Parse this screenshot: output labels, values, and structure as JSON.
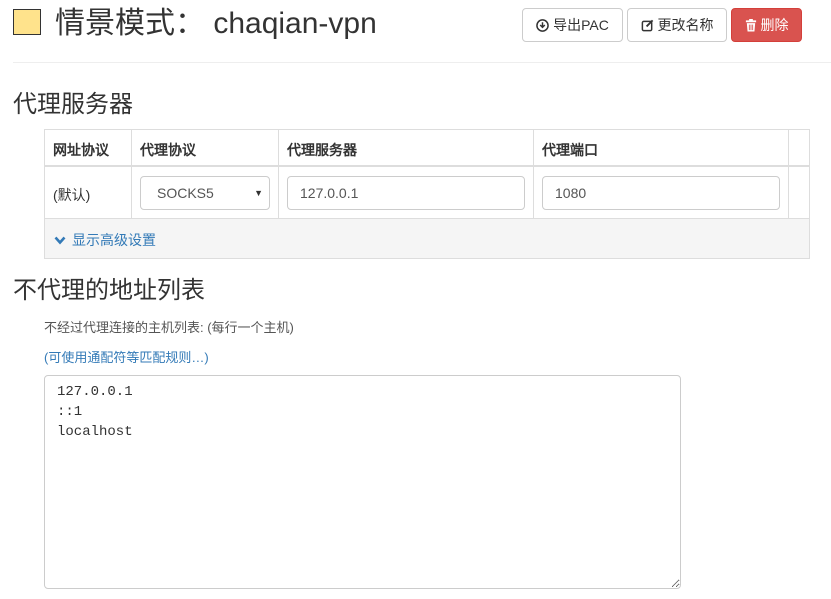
{
  "header": {
    "profile_color": "#ffe38c",
    "title": "情景模式： chaqian-vpn",
    "buttons": {
      "export": {
        "label": "导出PAC",
        "icon": "download-circle-icon"
      },
      "rename": {
        "label": "更改名称",
        "icon": "edit-icon"
      },
      "delete": {
        "label": "删除",
        "icon": "trash-icon",
        "color": "#d9534f"
      }
    }
  },
  "proxy_section": {
    "heading": "代理服务器",
    "columns": [
      "网址协议",
      "代理协议",
      "代理服务器",
      "代理端口"
    ],
    "rows": [
      {
        "scheme": "(默认)",
        "protocol": "SOCKS5",
        "server": "127.0.0.1",
        "port": "1080"
      }
    ],
    "advanced_link": {
      "label": "显示高级设置",
      "icon": "chevron-down-icon"
    }
  },
  "bypass_section": {
    "heading": "不代理的地址列表",
    "help_text": "不经过代理连接的主机列表: (每行一个主机)",
    "wildcard_link": "(可使用通配符等匹配规则…)",
    "entries": "127.0.0.1\n::1\nlocalhost"
  }
}
